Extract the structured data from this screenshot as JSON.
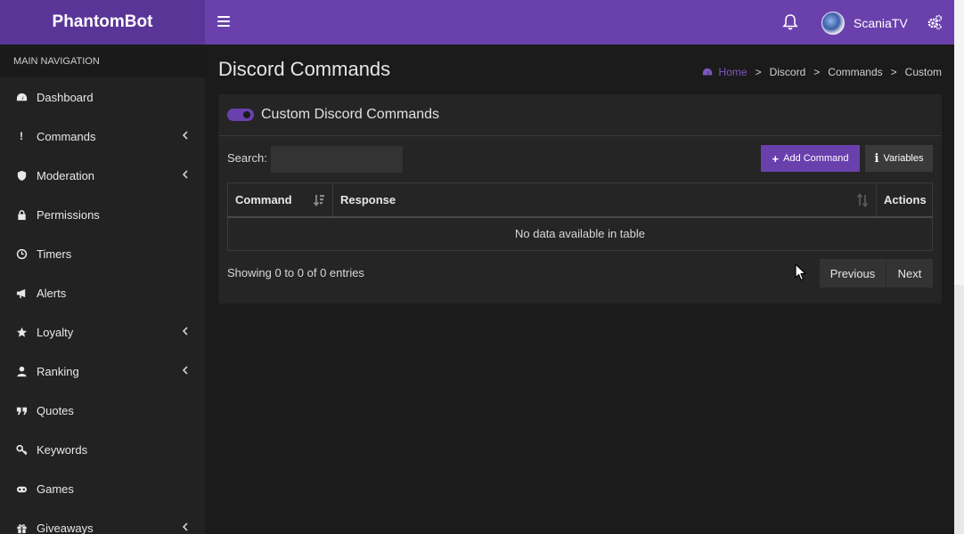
{
  "app": {
    "title": "PhantomBot"
  },
  "header": {
    "user_name": "ScaniaTV"
  },
  "sidebar": {
    "section_label": "MAIN NAVIGATION",
    "items": [
      {
        "label": "Dashboard",
        "icon": "dashboard-icon",
        "has_arrow": false
      },
      {
        "label": "Commands",
        "icon": "exclamation-icon",
        "has_arrow": true
      },
      {
        "label": "Moderation",
        "icon": "shield-icon",
        "has_arrow": true
      },
      {
        "label": "Permissions",
        "icon": "lock-icon",
        "has_arrow": false
      },
      {
        "label": "Timers",
        "icon": "clock-icon",
        "has_arrow": false
      },
      {
        "label": "Alerts",
        "icon": "bullhorn-icon",
        "has_arrow": false
      },
      {
        "label": "Loyalty",
        "icon": "star-icon",
        "has_arrow": true
      },
      {
        "label": "Ranking",
        "icon": "user-icon",
        "has_arrow": true
      },
      {
        "label": "Quotes",
        "icon": "quote-icon",
        "has_arrow": false
      },
      {
        "label": "Keywords",
        "icon": "key-icon",
        "has_arrow": false
      },
      {
        "label": "Games",
        "icon": "gamepad-icon",
        "has_arrow": false
      },
      {
        "label": "Giveaways",
        "icon": "gift-icon",
        "has_arrow": true
      }
    ]
  },
  "page": {
    "title": "Discord Commands",
    "breadcrumb": [
      "Home",
      "Discord",
      "Commands",
      "Custom"
    ],
    "breadcrumb_separator": ">"
  },
  "panel": {
    "title": "Custom Discord Commands",
    "search_label": "Search:",
    "search_value": "",
    "add_button": "Add Command",
    "variables_button": "Variables",
    "table": {
      "columns": [
        "Command",
        "Response",
        "Actions"
      ],
      "empty_message": "No data available in table"
    },
    "info_text": "Showing 0 to 0 of 0 entries",
    "pagination": {
      "previous": "Previous",
      "next": "Next"
    }
  },
  "colors": {
    "accent": "#6a40ad",
    "header_dark": "#5a3598",
    "background": "#1b1b1b",
    "sidebar": "#222222",
    "panel": "#252525"
  }
}
